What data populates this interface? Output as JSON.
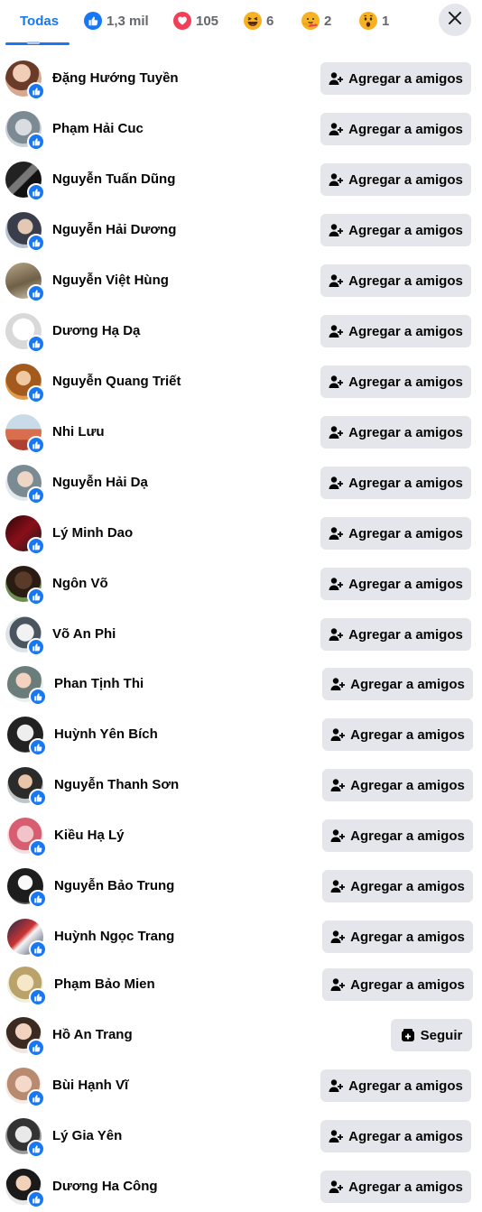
{
  "tabs": [
    {
      "label": "Todas",
      "type": "all",
      "active": true
    },
    {
      "label": "1,3 mil",
      "type": "like"
    },
    {
      "label": "105",
      "type": "love"
    },
    {
      "label": "6",
      "type": "haha"
    },
    {
      "label": "2",
      "type": "care"
    },
    {
      "label": "1",
      "type": "wow"
    }
  ],
  "close_icon": "close-icon",
  "colors": {
    "accent": "#1877f2",
    "button_bg": "#e4e6eb",
    "muted_text": "#65676b",
    "love": "#f33e58",
    "yellow": "#f7b125"
  },
  "people": [
    {
      "name": "Đặng Hướng Tuyền",
      "action": "Agregar a amigos",
      "kind": "add"
    },
    {
      "name": "Phạm Hải Cuc",
      "action": "Agregar a amigos",
      "kind": "add"
    },
    {
      "name": "Nguyễn Tuấn Dũng",
      "action": "Agregar a amigos",
      "kind": "add"
    },
    {
      "name": "Nguyễn Hải Dương",
      "action": "Agregar a amigos",
      "kind": "add"
    },
    {
      "name": "Nguyễn Việt Hùng",
      "action": "Agregar a amigos",
      "kind": "add"
    },
    {
      "name": "Dương Hạ Dạ",
      "action": "Agregar a amigos",
      "kind": "add"
    },
    {
      "name": "Nguyễn Quang Triết",
      "action": "Agregar a amigos",
      "kind": "add"
    },
    {
      "name": "Nhi Lưu",
      "action": "Agregar a amigos",
      "kind": "add"
    },
    {
      "name": "Nguyễn Hải Dạ",
      "action": "Agregar a amigos",
      "kind": "add"
    },
    {
      "name": "Lý Minh Dao",
      "action": "Agregar a amigos",
      "kind": "add"
    },
    {
      "name": "Ngôn Võ",
      "action": "Agregar a amigos",
      "kind": "add"
    },
    {
      "name": "Võ An Phi",
      "action": "Agregar a amigos",
      "kind": "add"
    },
    {
      "name": "Phan Tịnh Thi",
      "action": "Agregar a amigos",
      "kind": "add"
    },
    {
      "name": "Huỳnh Yên Bích",
      "action": "Agregar a amigos",
      "kind": "add"
    },
    {
      "name": "Nguyễn Thanh Sơn",
      "action": "Agregar a amigos",
      "kind": "add"
    },
    {
      "name": "Kiều Hạ Lý",
      "action": "Agregar a amigos",
      "kind": "add"
    },
    {
      "name": "Nguyễn Bảo Trung",
      "action": "Agregar a amigos",
      "kind": "add"
    },
    {
      "name": "Huỳnh Ngọc Trang",
      "action": "Agregar a amigos",
      "kind": "add"
    },
    {
      "name": "Phạm Bảo Mien",
      "action": "Agregar a amigos",
      "kind": "add"
    },
    {
      "name": "Hồ An Trang",
      "action": "Seguir",
      "kind": "follow"
    },
    {
      "name": "Bùi Hạnh Vĩ",
      "action": "Agregar a amigos",
      "kind": "add"
    },
    {
      "name": "Lý Gia Yên",
      "action": "Agregar a amigos",
      "kind": "add"
    },
    {
      "name": "Dương Ha Công",
      "action": "Agregar a amigos",
      "kind": "add"
    }
  ]
}
